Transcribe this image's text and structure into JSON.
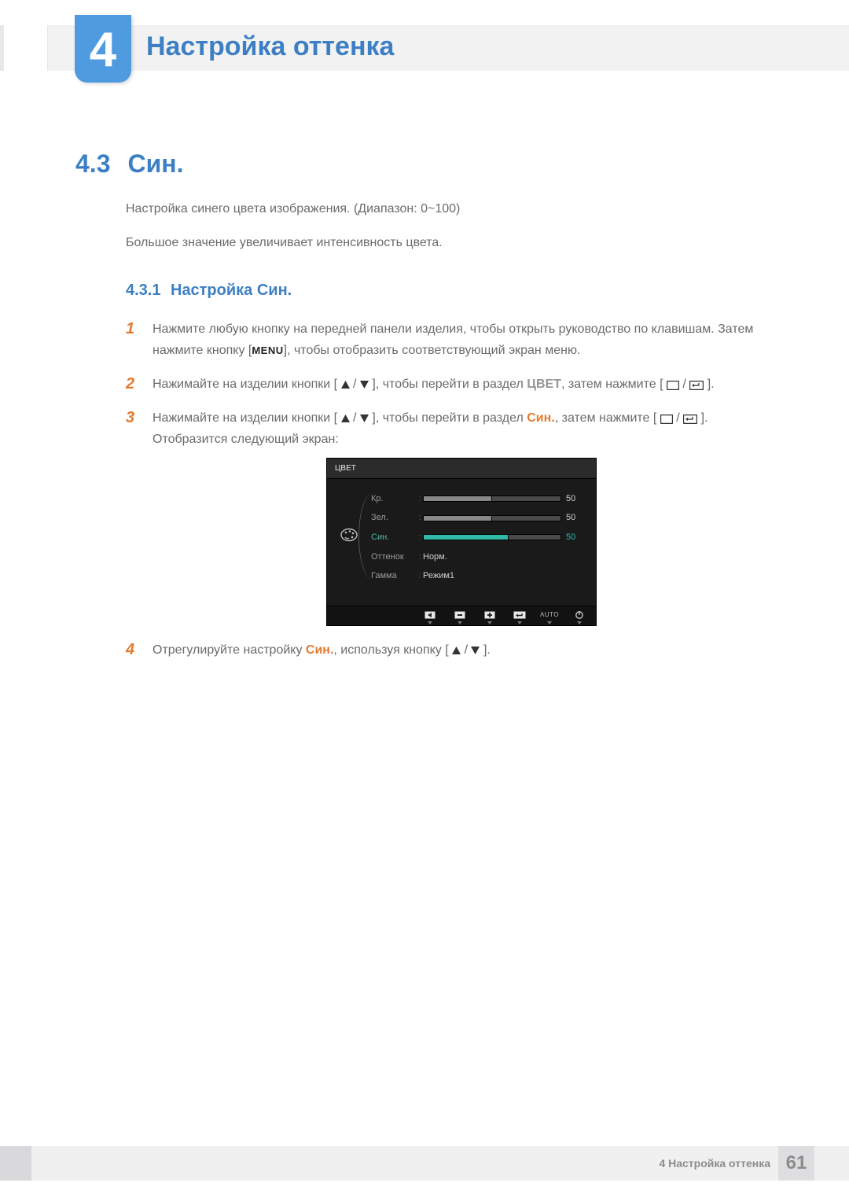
{
  "chapter": {
    "number": "4",
    "title": "Настройка оттенка"
  },
  "section": {
    "number": "4.3",
    "name": "Син."
  },
  "intro": {
    "p1": "Настройка синего цвета изображения. (Диапазон: 0~100)",
    "p2": "Большое значение увеличивает интенсивность цвета."
  },
  "subsection": {
    "number": "4.3.1",
    "name": "Настройка Син."
  },
  "steps": {
    "s1_num": "1",
    "s1_a": "Нажмите любую кнопку на передней панели изделия, чтобы открыть руководство по клавишам. Затем нажмите кнопку [",
    "s1_menu": "MENU",
    "s1_b": "], чтобы отобразить соответствующий экран меню.",
    "s2_num": "2",
    "s2_a": "Нажимайте на изделии кнопки [",
    "s2_b": "], чтобы перейти в раздел ",
    "s2_section": "ЦВЕТ",
    "s2_c": ", затем нажмите [",
    "s2_d": "].",
    "s3_num": "3",
    "s3_a": "Нажимайте на изделии кнопки [",
    "s3_b": "], чтобы перейти в раздел ",
    "s3_section": "Син.",
    "s3_c": ", затем нажмите [",
    "s3_d": "]. Отобразится следующий экран:",
    "s4_num": "4",
    "s4_a": "Отрегулируйте настройку ",
    "s4_section": "Син.",
    "s4_b": ", используя кнопку [",
    "s4_c": "]."
  },
  "osd": {
    "title": "ЦВЕТ",
    "rows": {
      "red": {
        "label": "Кр.",
        "value": "50",
        "pct": 50
      },
      "green": {
        "label": "Зел.",
        "value": "50",
        "pct": 50
      },
      "blue": {
        "label": "Син.",
        "value": "50",
        "pct": 62
      },
      "tone": {
        "label": "Оттенок",
        "value": "Норм."
      },
      "gamma": {
        "label": "Гамма",
        "value": "Режим1"
      }
    },
    "footer_auto": "AUTO"
  },
  "footer": {
    "label": "4 Настройка оттенка",
    "page": "61"
  },
  "chart_data": {
    "type": "table",
    "title": "ЦВЕТ",
    "rows": [
      {
        "label": "Кр.",
        "value": 50,
        "range": [
          0,
          100
        ],
        "selected": false
      },
      {
        "label": "Зел.",
        "value": 50,
        "range": [
          0,
          100
        ],
        "selected": false
      },
      {
        "label": "Син.",
        "value": 50,
        "range": [
          0,
          100
        ],
        "selected": true
      },
      {
        "label": "Оттенок",
        "value": "Норм."
      },
      {
        "label": "Гамма",
        "value": "Режим1"
      }
    ]
  }
}
